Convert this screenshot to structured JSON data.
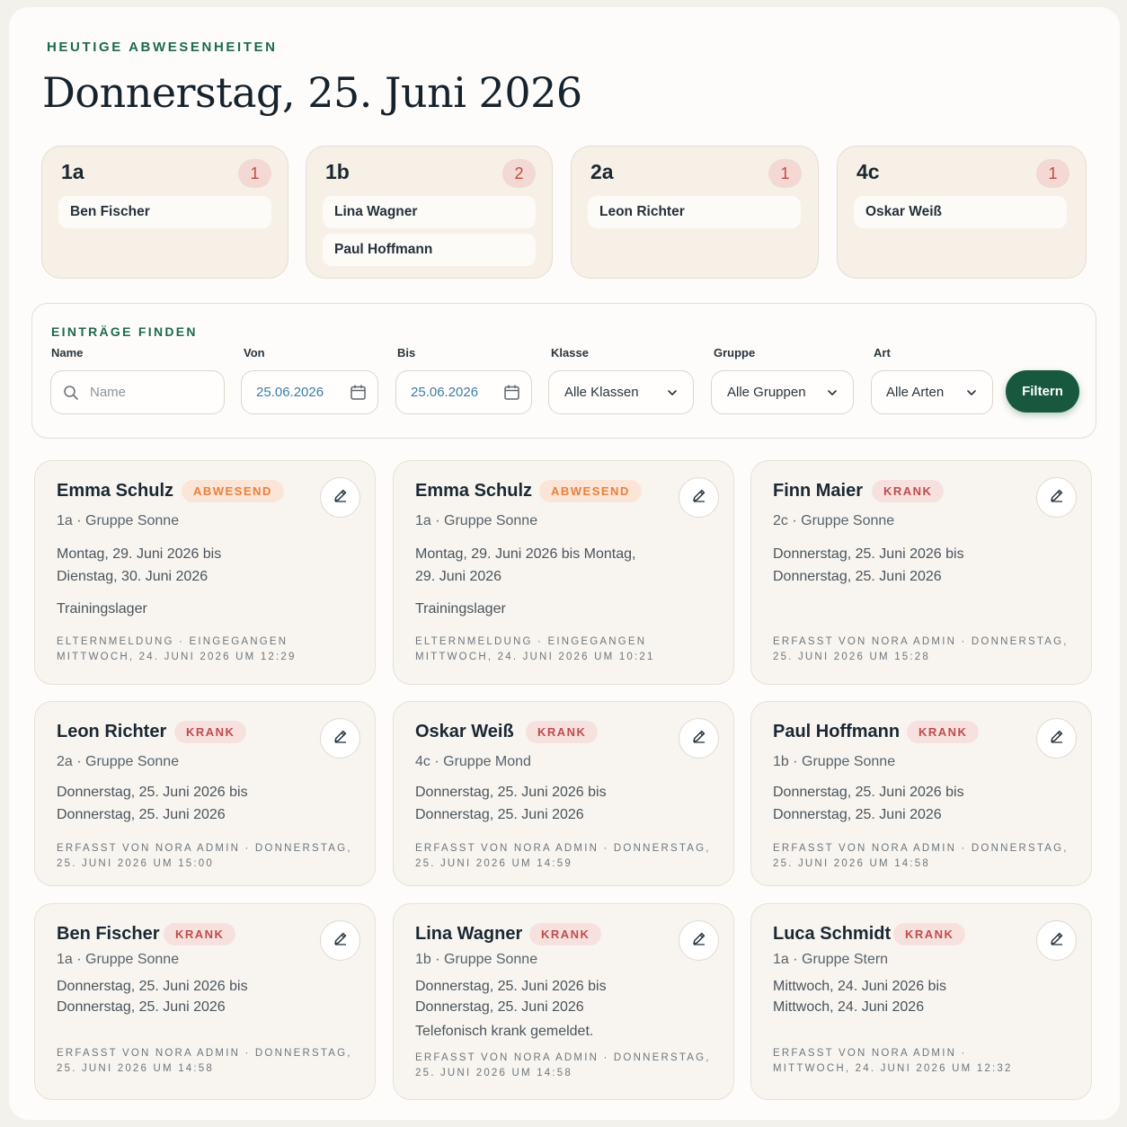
{
  "header": {
    "eyebrow": "HEUTIGE ABWESENHEITEN",
    "title": "Donnerstag, 25. Juni 2026"
  },
  "classes": [
    {
      "name": "1a",
      "count": "1",
      "students": [
        "Ben Fischer"
      ]
    },
    {
      "name": "1b",
      "count": "2",
      "students": [
        "Lina Wagner",
        "Paul Hoffmann"
      ]
    },
    {
      "name": "2a",
      "count": "1",
      "students": [
        "Leon Richter"
      ]
    },
    {
      "name": "4c",
      "count": "1",
      "students": [
        "Oskar Weiß"
      ]
    }
  ],
  "filters": {
    "title": "EINTRÄGE FINDEN",
    "name_label": "Name",
    "name_placeholder": "Name",
    "von_label": "Von",
    "von_value": "25.06.2026",
    "bis_label": "Bis",
    "bis_value": "25.06.2026",
    "klasse_label": "Klasse",
    "klasse_value": "Alle Klassen",
    "gruppe_label": "Gruppe",
    "gruppe_value": "Alle Gruppen",
    "art_label": "Art",
    "art_value": "Alle Arten",
    "submit_label": "Filtern"
  },
  "entries": [
    {
      "name": "Emma Schulz",
      "status": "ABWESEND",
      "status_kind": "abwesend",
      "meta": "1a · Gruppe Sonne",
      "range": "Montag, 29. Juni 2026 bis Dienstag, 30. Juni 2026",
      "note": "Trainingslager",
      "footer": "ELTERNMELDUNG · EINGEGANGEN MITTWOCH, 24. JUNI 2026 UM 12:29"
    },
    {
      "name": "Emma Schulz",
      "status": "ABWESEND",
      "status_kind": "abwesend",
      "meta": "1a · Gruppe Sonne",
      "range": "Montag, 29. Juni 2026 bis Montag, 29. Juni 2026",
      "note": "Trainingslager",
      "footer": "ELTERNMELDUNG · EINGEGANGEN MITTWOCH, 24. JUNI 2026 UM 10:21"
    },
    {
      "name": "Finn Maier",
      "status": "KRANK",
      "status_kind": "krank",
      "meta": "2c · Gruppe Sonne",
      "range": "Donnerstag, 25. Juni 2026 bis Donnerstag, 25. Juni 2026",
      "note": "",
      "footer": "ERFASST VON NORA ADMIN · DONNERSTAG, 25. JUNI 2026 UM 15:28"
    },
    {
      "name": "Leon Richter",
      "status": "KRANK",
      "status_kind": "krank",
      "meta": "2a · Gruppe Sonne",
      "range": "Donnerstag, 25. Juni 2026 bis Donnerstag, 25. Juni 2026",
      "note": "",
      "footer": "ERFASST VON NORA ADMIN · DONNERSTAG, 25. JUNI 2026 UM 15:00"
    },
    {
      "name": "Oskar Weiß",
      "status": "KRANK",
      "status_kind": "krank",
      "meta": "4c · Gruppe Mond",
      "range": "Donnerstag, 25. Juni 2026 bis Donnerstag, 25. Juni 2026",
      "note": "",
      "footer": "ERFASST VON NORA ADMIN · DONNERSTAG, 25. JUNI 2026 UM 14:59"
    },
    {
      "name": "Paul Hoffmann",
      "status": "KRANK",
      "status_kind": "krank",
      "meta": "1b · Gruppe Sonne",
      "range": "Donnerstag, 25. Juni 2026 bis Donnerstag, 25. Juni 2026",
      "note": "",
      "footer": "ERFASST VON NORA ADMIN · DONNERSTAG, 25. JUNI 2026 UM 14:58"
    },
    {
      "name": "Ben Fischer",
      "status": "KRANK",
      "status_kind": "krank",
      "meta": "1a · Gruppe Sonne",
      "range": "Donnerstag, 25. Juni 2026 bis Donnerstag, 25. Juni 2026",
      "note": "",
      "footer": "ERFASST VON NORA ADMIN · DONNERSTAG, 25. JUNI 2026 UM 14:58"
    },
    {
      "name": "Lina Wagner",
      "status": "KRANK",
      "status_kind": "krank",
      "meta": "1b · Gruppe Sonne",
      "range": "Donnerstag, 25. Juni 2026 bis Donnerstag, 25. Juni 2026",
      "note": "Telefonisch krank gemeldet.",
      "footer": "ERFASST VON NORA ADMIN · DONNERSTAG, 25. JUNI 2026 UM 14:58"
    },
    {
      "name": "Luca Schmidt",
      "status": "KRANK",
      "status_kind": "krank",
      "meta": "1a · Gruppe Stern",
      "range": "Mittwoch, 24. Juni 2026 bis Mittwoch, 24. Juni 2026",
      "note": "",
      "footer": "ERFASST VON NORA ADMIN · MITTWOCH, 24. JUNI 2026 UM 12:32"
    }
  ],
  "colors": {
    "accent_green": "#1d6a4e",
    "button_green": "#17583f",
    "abwesend": "#e8803f",
    "krank": "#bf4c4c"
  }
}
